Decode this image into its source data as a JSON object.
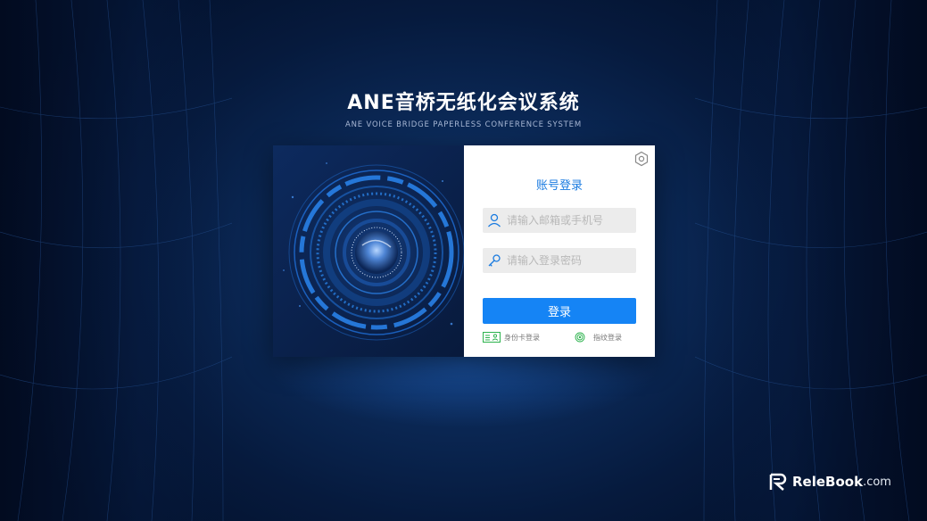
{
  "app": {
    "title": "ANE音桥无纸化会议系统",
    "subtitle": "ANE VOICE BRIDGE PAPERLESS CONFERENCE SYSTEM"
  },
  "login": {
    "heading": "账号登录",
    "username_placeholder": "请输入邮箱或手机号",
    "password_placeholder": "请输入登录密码",
    "submit_label": "登录",
    "id_card_login": "身份卡登录",
    "fingerprint_login": "指纹登录"
  },
  "icons": {
    "settings": "hexagon-settings-icon",
    "user": "user-icon",
    "password": "key-icon",
    "id_card": "id-card-icon",
    "fingerprint": "fingerprint-icon"
  },
  "colors": {
    "accent": "#1584f5",
    "heading": "#1a7be0",
    "background": "#061a3d"
  },
  "watermark": {
    "name": "ReleBook",
    "suffix": ".com"
  }
}
